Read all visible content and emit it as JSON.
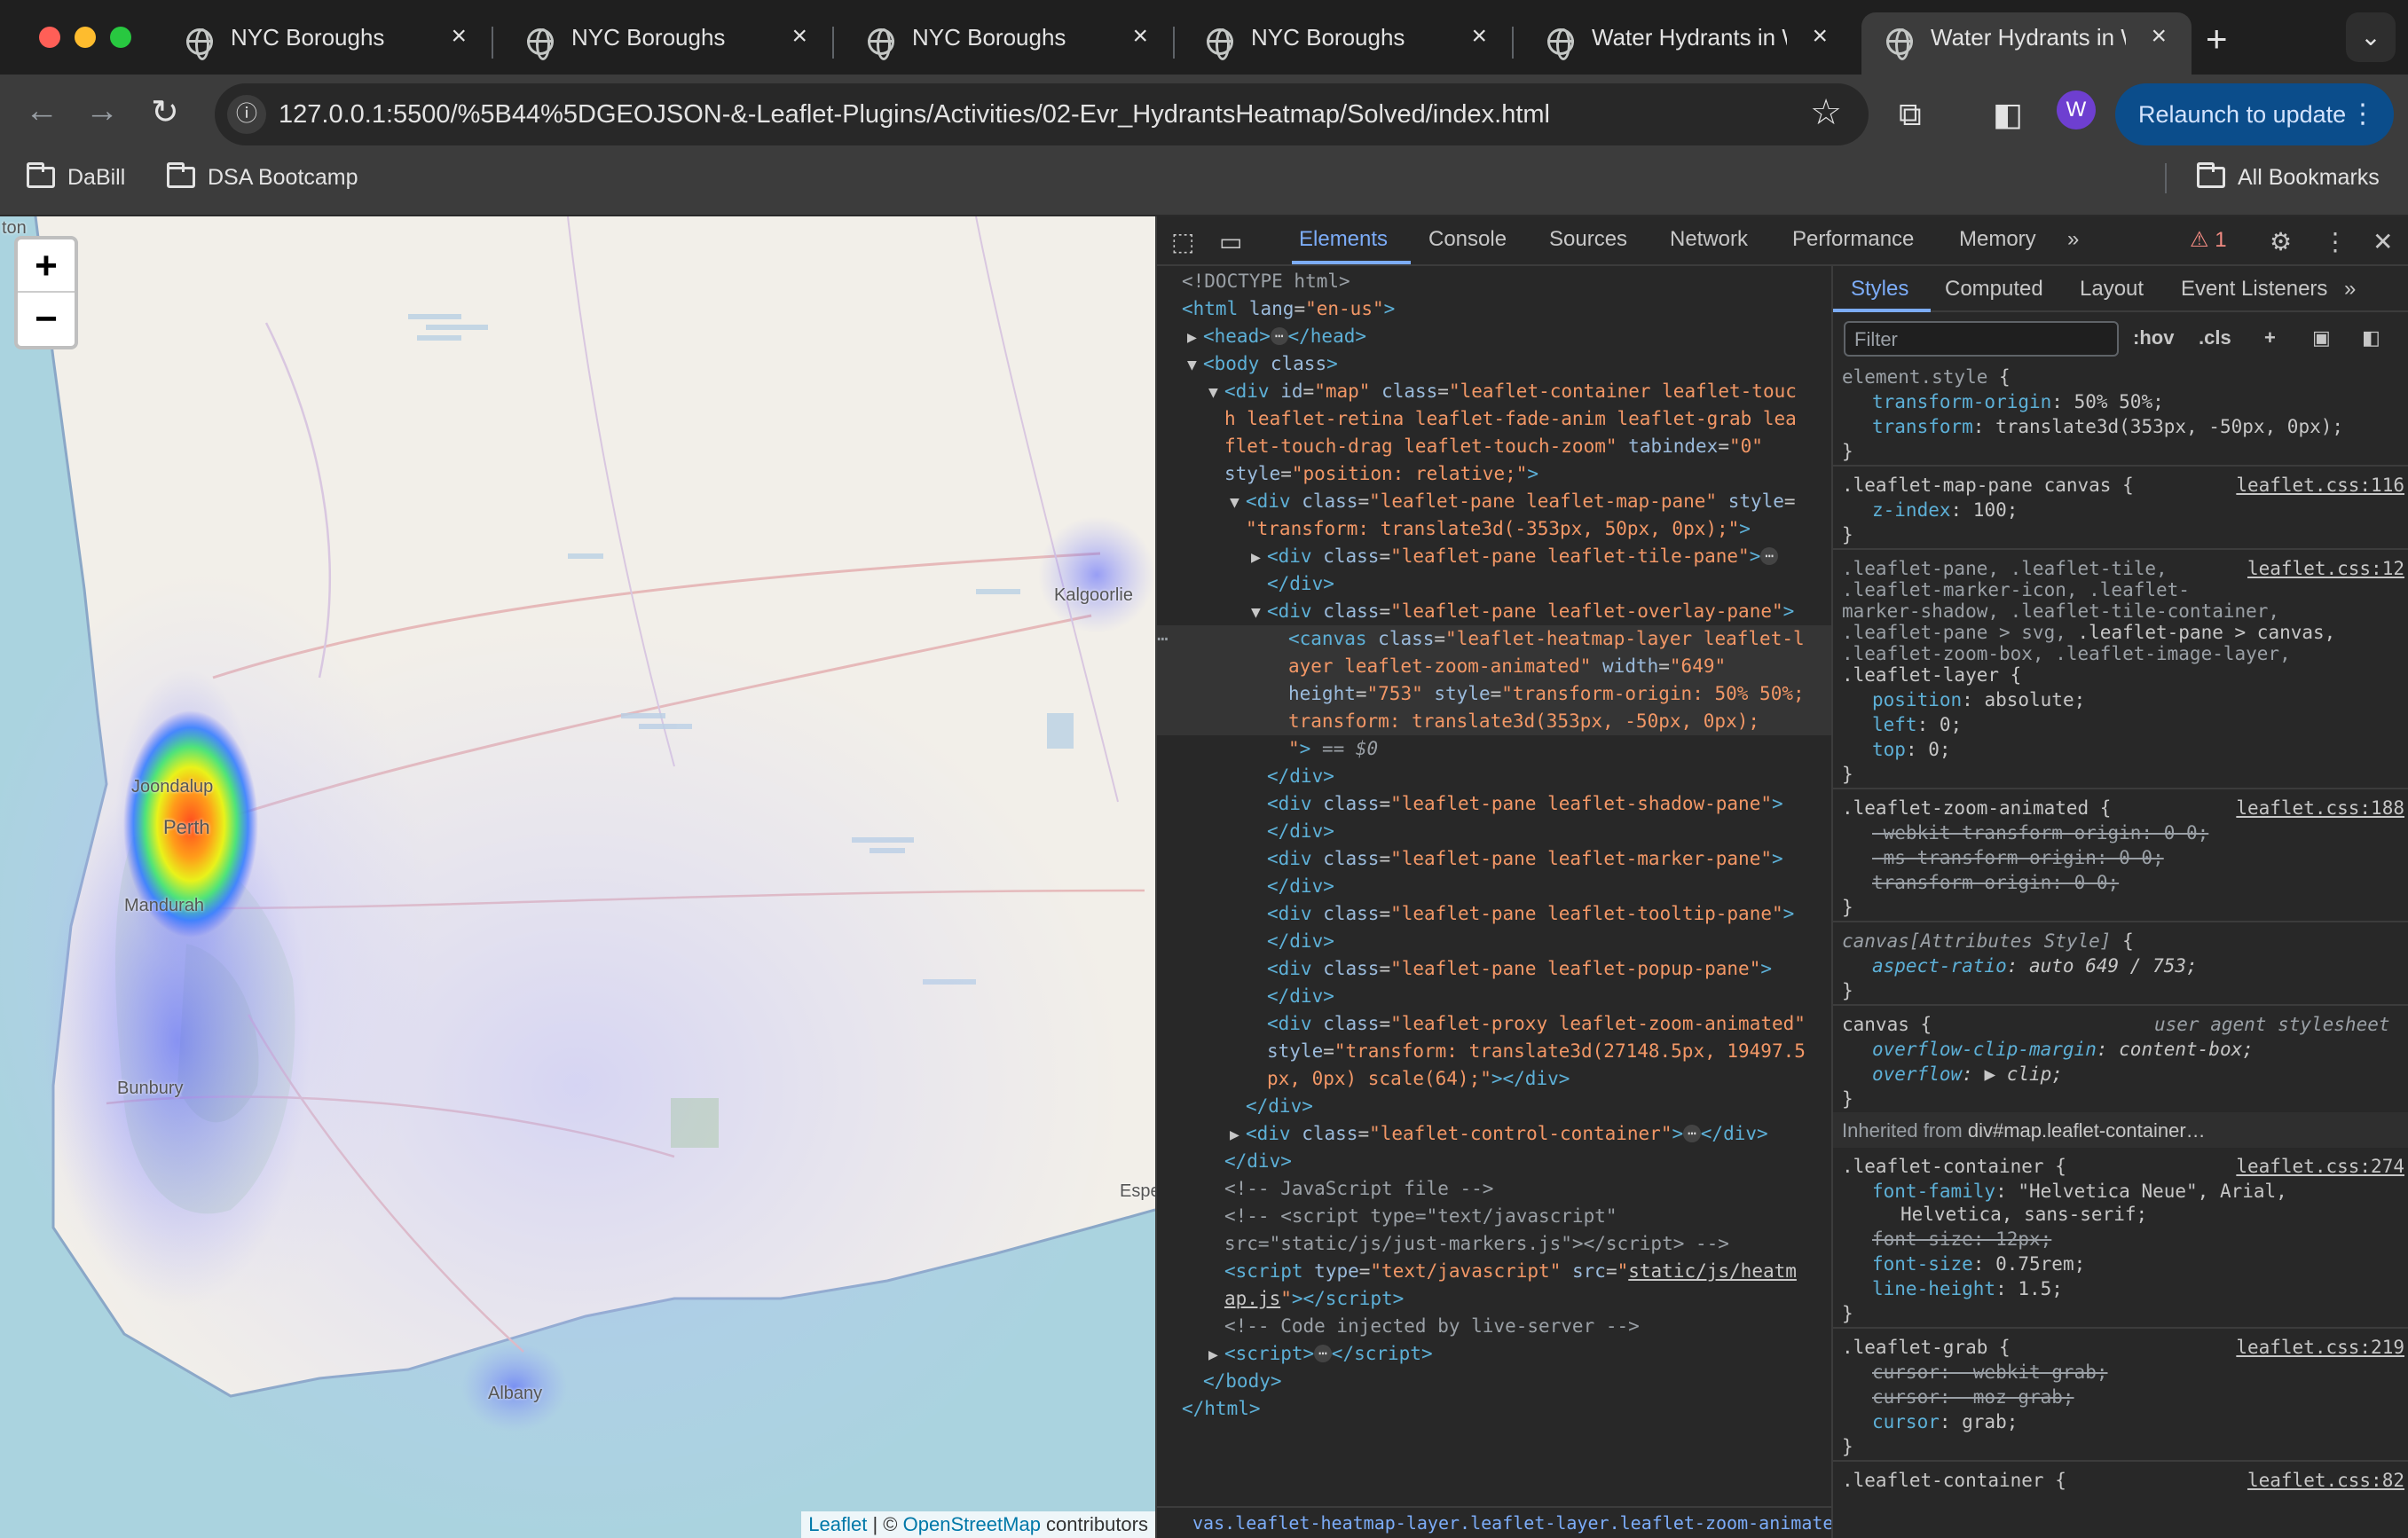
{
  "tabs": [
    {
      "title": "NYC Boroughs"
    },
    {
      "title": "NYC Boroughs"
    },
    {
      "title": "NYC Boroughs"
    },
    {
      "title": "NYC Boroughs"
    },
    {
      "title": "Water Hydrants in We"
    },
    {
      "title": "Water Hydrants in We"
    }
  ],
  "address": {
    "url": "127.0.0.1:5500/%5B44%5DGEOJSON-&-Leaflet-Plugins/Activities/02-Evr_HydrantsHeatmap/Solved/index.html"
  },
  "profile": {
    "initial": "W"
  },
  "relaunch": {
    "label": "Relaunch to update"
  },
  "bookmarks": {
    "items": [
      "DaBill",
      "DSA Bootcamp"
    ],
    "all": "All Bookmarks"
  },
  "map": {
    "zoom_in": "+",
    "zoom_out": "−",
    "cities": [
      "ton",
      "Kalgoorlie",
      "Joondalup",
      "Perth",
      "Mandurah",
      "Bunbury",
      "Albany",
      "Espe"
    ],
    "attribution": {
      "leaflet": "Leaflet",
      "sep": " | © ",
      "osm": "OpenStreetMap",
      "tail": " contributors"
    }
  },
  "devtools": {
    "tabs": [
      "Elements",
      "Console",
      "Sources",
      "Network",
      "Performance",
      "Memory"
    ],
    "more": "»",
    "warnings": "1",
    "breadcrumb": "vas.leaflet-heatmap-layer.leaflet-layer.leaflet-zoom-animated",
    "styles_tabs": [
      "Styles",
      "Computed",
      "Layout",
      "Event Listeners"
    ],
    "filter_placeholder": "Filter",
    "hov": ":hov",
    "cls": ".cls",
    "inherited_label": "Inherited from ",
    "inherited_target": "div#map.leaflet-container…"
  },
  "colors": {
    "accent": "#7cacf8",
    "tag": "#5db0d7",
    "attr_value": "#f29766",
    "relaunch_bg": "#0b4d8b",
    "avatar_bg": "#6e3fd0"
  }
}
